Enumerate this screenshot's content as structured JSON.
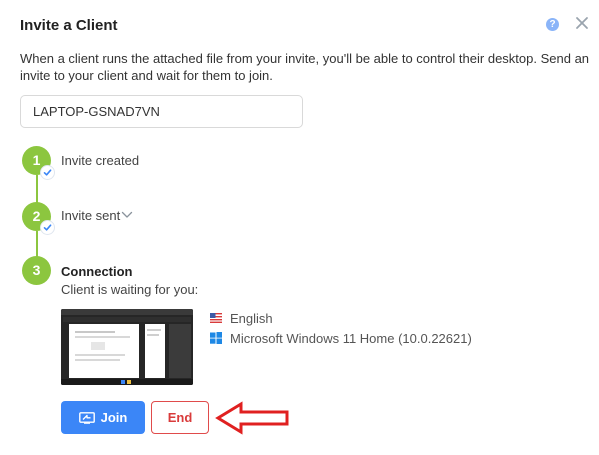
{
  "dialog": {
    "title": "Invite a Client",
    "description": "When a client runs the attached file from your invite, you'll be able to control their desktop. Send an invite to your client and wait for them to join.",
    "help_icon": "question-circle-icon",
    "close_icon": "close-icon"
  },
  "name_field": {
    "value": "LAPTOP-GSNAD7VN"
  },
  "steps": [
    {
      "number": "1",
      "label": "Invite created",
      "completed": true
    },
    {
      "number": "2",
      "label": "Invite sent",
      "completed": true,
      "expandable": true
    },
    {
      "number": "3",
      "label": "Connection",
      "completed": false,
      "sublabel": "Client is waiting for you:"
    }
  ],
  "client": {
    "language": "English",
    "language_icon": "us-flag-icon",
    "os": "Microsoft Windows 11 Home (10.0.22621)",
    "os_icon": "windows-logo-icon"
  },
  "buttons": {
    "join_label": "Join",
    "end_label": "End"
  },
  "colors": {
    "step_green": "#8cc63f",
    "primary_blue": "#3b86f7",
    "danger_red": "#d93b3b",
    "annotation_arrow": "#e02020"
  }
}
